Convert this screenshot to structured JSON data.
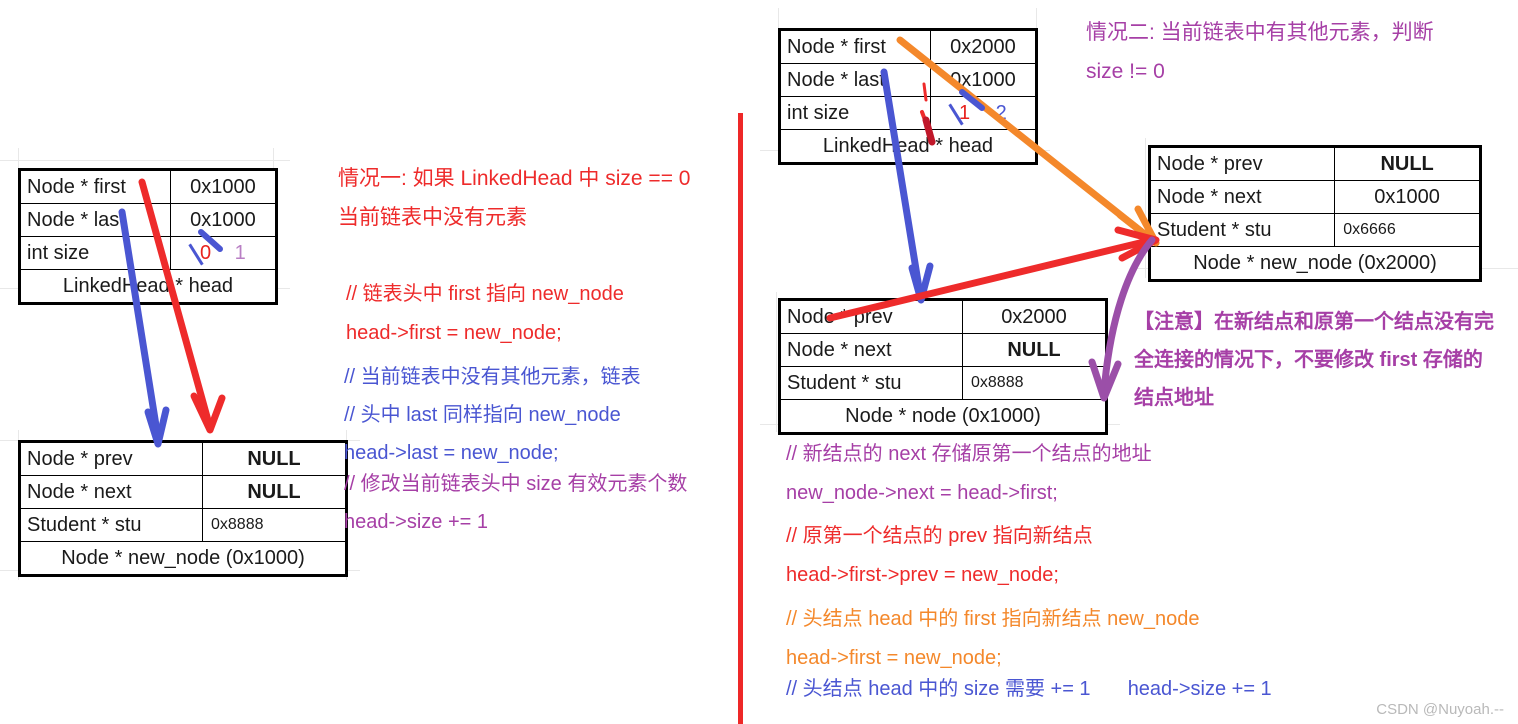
{
  "meta": {
    "watermark": "CSDN @Nuyoah.--"
  },
  "colors": {
    "red": "#ee2b2b",
    "blue": "#4a56d2",
    "purple": "#a63fa6",
    "orange": "#f4882b",
    "navy": "#12265e",
    "divider": "#ee2828"
  },
  "case1": {
    "heading": [
      "情况一: 如果 LinkedHead 中 size == 0",
      "当前链表中没有元素"
    ],
    "head_table": {
      "caption": "LinkedHead * head",
      "rows": [
        {
          "field": "Node * first",
          "value": "0x1000"
        },
        {
          "field": "Node * last",
          "value": "0x1000"
        },
        {
          "field": "int size",
          "value": "1",
          "old_value": "0"
        }
      ]
    },
    "node_table": {
      "caption": "Node * new_node (0x1000)",
      "rows": [
        {
          "field": "Node * prev",
          "value": "NULL"
        },
        {
          "field": "Node * next",
          "value": "NULL"
        },
        {
          "field": "Student * stu",
          "value": "0x8888"
        }
      ]
    },
    "code": [
      {
        "comment": "// 链表头中 first 指向 new_node",
        "stmt": "head->first = new_node;"
      },
      {
        "comment": "// 当前链表中没有其他元素，链表",
        "comment2": "// 头中 last 同样指向 new_node",
        "stmt": "head->last = new_node;"
      },
      {
        "comment": "// 修改当前链表头中 size 有效元素个数",
        "stmt": "head->size += 1"
      }
    ]
  },
  "case2": {
    "heading": [
      "情况二: 当前链表中有其他元素，判断",
      "size != 0"
    ],
    "head_table": {
      "caption": "LinkedHead * head",
      "rows": [
        {
          "field": "Node * first",
          "value": "0x2000"
        },
        {
          "field": "Node * last",
          "value": "0x1000"
        },
        {
          "field": "int size",
          "value": "2",
          "old_value": "1"
        }
      ]
    },
    "new_node_table": {
      "caption": "Node * new_node (0x2000)",
      "rows": [
        {
          "field": "Node * prev",
          "value": "NULL"
        },
        {
          "field": "Node * next",
          "value": "0x1000"
        },
        {
          "field": "Student * stu",
          "value": "0x6666"
        }
      ]
    },
    "node_table": {
      "caption": "Node * node (0x1000)",
      "rows": [
        {
          "field": "Node * prev",
          "value": "0x2000"
        },
        {
          "field": "Node * next",
          "value": "NULL"
        },
        {
          "field": "Student * stu",
          "value": "0x8888"
        }
      ]
    },
    "warning": [
      "【注意】在新结点和原第一个结点没有完",
      "全连接的情况下，不要修改 first 存储的",
      "结点地址"
    ],
    "code": [
      {
        "comment": "// 新结点的 next 存储原第一个结点的地址",
        "stmt": "new_node->next = head->first;"
      },
      {
        "comment": "// 原第一个结点的 prev 指向新结点",
        "stmt": "head->first->prev = new_node;"
      },
      {
        "comment": "// 头结点 head 中的 first 指向新结点 new_node",
        "stmt": "head->first = new_node;"
      },
      {
        "comment": "// 头结点 head 中的 size 需要 += 1",
        "stmt": "head->size += 1"
      }
    ]
  }
}
